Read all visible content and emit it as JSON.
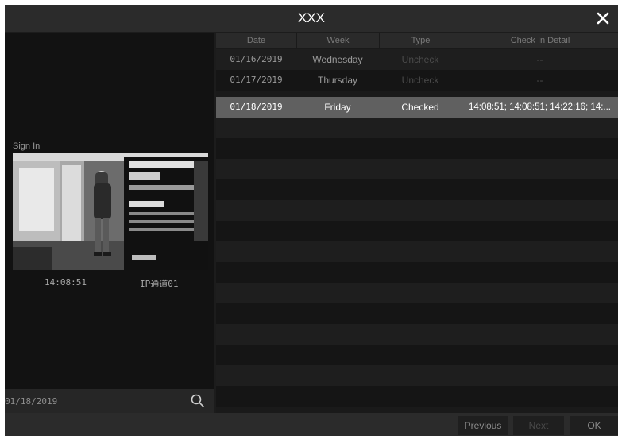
{
  "dialog": {
    "title": "XXX"
  },
  "left_panel": {
    "sign_in_label": "Sign In",
    "snapshot_time": "14:08:51",
    "snapshot_channel": "IP通道01",
    "date_value": "01/18/2019"
  },
  "table": {
    "columns": [
      "Date",
      "Week",
      "Type",
      "Check In Detail"
    ],
    "rows": [
      {
        "date": "01/16/2019",
        "week": "Wednesday",
        "type": "Uncheck",
        "detail": "--"
      },
      {
        "date": "01/17/2019",
        "week": "Thursday",
        "type": "Uncheck",
        "detail": "--"
      },
      {
        "date": "01/18/2019",
        "week": "Friday",
        "type": "Checked",
        "detail": "14:08:51; 14:08:51; 14:22:16; 14:..."
      }
    ],
    "selected_row": 2
  },
  "footer": {
    "previous_label": "Previous",
    "next_label": "Next",
    "ok_label": "OK"
  },
  "colors": {
    "background": "#1c1c1c",
    "selected_row": "#606060",
    "header": "#2b2b2b"
  },
  "icons": {
    "close": "close-icon",
    "search": "search-icon"
  }
}
